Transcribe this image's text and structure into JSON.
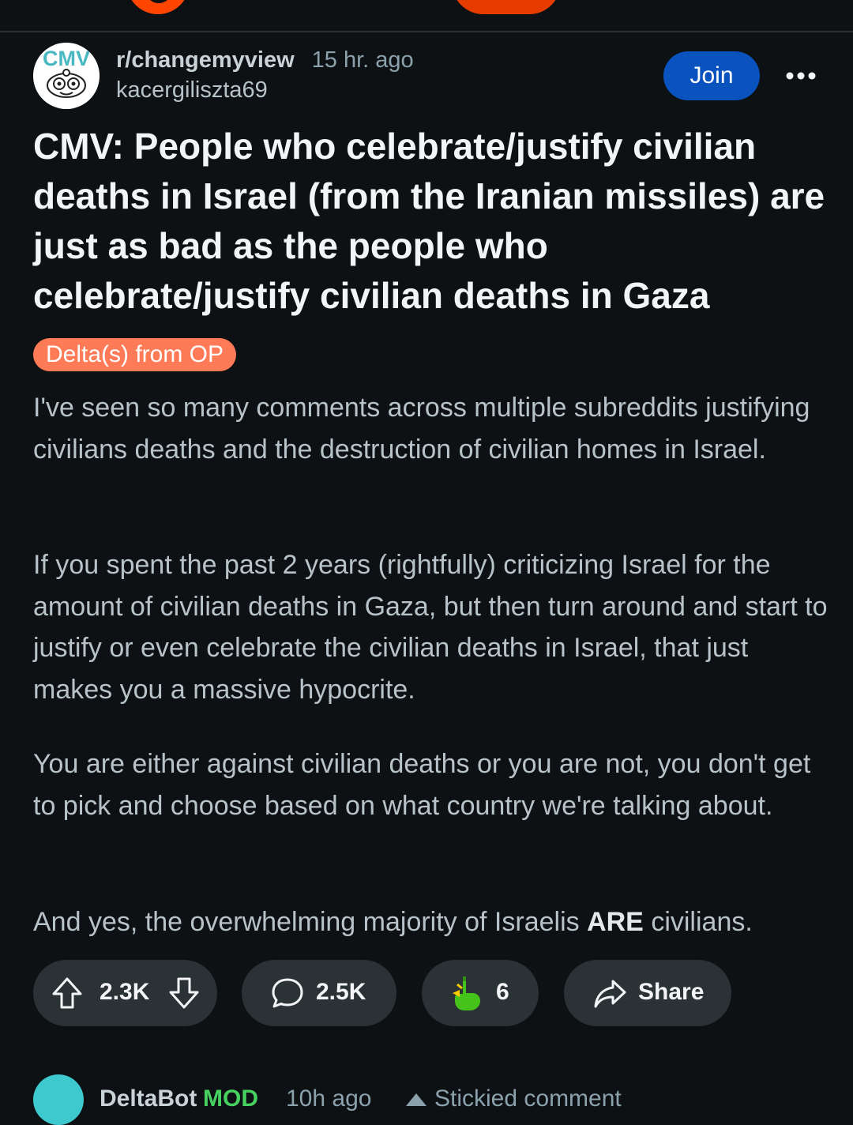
{
  "post": {
    "subreddit": "r/changemyview",
    "time_ago": "15 hr. ago",
    "author": "kacergiliszta69",
    "join_label": "Join",
    "title": "CMV: People who celebrate/justify civilian deaths in Israel (from the Iranian missiles) are just as bad as the people who celebrate/justify civilian deaths in Gaza",
    "flair": "Delta(s) from OP",
    "body": {
      "p1": "I've seen so many comments across multiple subreddits justifying civilians deaths and the destruction of civilian homes in Israel.",
      "p2": "If you spent the past 2 years (rightfully) criticizing Israel for the amount of civilian deaths in Gaza, but then turn around and start to justify or even celebrate the civilian deaths in Israel, that just makes you a massive hypocrite.",
      "p3": "You are either against civilian deaths or you are not, you don't get to pick and choose based on what country we're talking about.",
      "p4_before": "And yes, the overwhelming majority of Israelis ",
      "p4_bold": "ARE",
      "p4_after": " civilians."
    }
  },
  "actions": {
    "votes": "2.3K",
    "comments": "2.5K",
    "awards": "6",
    "share_label": "Share"
  },
  "next_comment": {
    "author": "DeltaBot",
    "badge": "MOD",
    "time_ago": "10h ago",
    "label": "Stickied comment"
  },
  "colors": {
    "background": "#0e1113",
    "join": "#0a53be",
    "flair": "#ff7b57",
    "pill": "#2a3236",
    "mod": "#46d160"
  },
  "icons": {
    "upvote": "arrow-up-outline",
    "downvote": "arrow-down-outline",
    "comment": "speech-bubble",
    "award": "pointing-hand",
    "share": "forward-arrow",
    "more": "three-dots"
  }
}
